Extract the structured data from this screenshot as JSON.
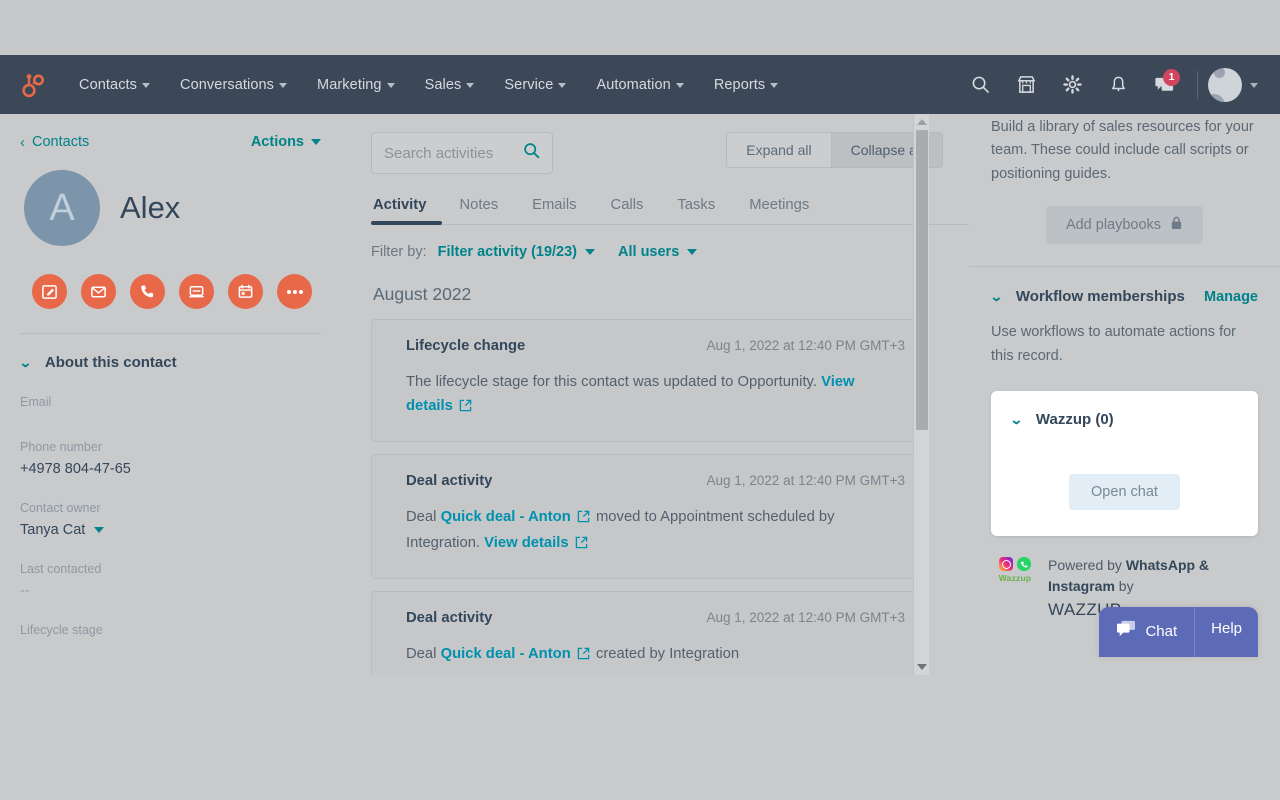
{
  "navbar": {
    "logo_icon": "hubspot-sprocket-logo",
    "menu": [
      {
        "label": "Contacts",
        "has_caret": true
      },
      {
        "label": "Conversations",
        "has_caret": true
      },
      {
        "label": "Marketing",
        "has_caret": true
      },
      {
        "label": "Sales",
        "has_caret": true
      },
      {
        "label": "Service",
        "has_caret": true
      },
      {
        "label": "Automation",
        "has_caret": true
      },
      {
        "label": "Reports",
        "has_caret": true
      }
    ],
    "icons": [
      "search-icon",
      "marketplace-icon",
      "gear-icon",
      "bell-icon",
      "notifications-icon"
    ],
    "notification_count": "1",
    "accent_color": "#e8694a",
    "bar_color": "#3c4858",
    "badge_color": "#d2455f"
  },
  "left_panel": {
    "back_label": "Contacts",
    "actions_label": "Actions",
    "avatar_initial": "A",
    "contact_name": "Alex",
    "quick_actions": [
      {
        "name": "note-icon"
      },
      {
        "name": "email-icon"
      },
      {
        "name": "call-icon"
      },
      {
        "name": "log-activity-icon"
      },
      {
        "name": "meeting-icon"
      },
      {
        "name": "more-icon"
      }
    ],
    "about": {
      "title": "About this contact",
      "fields": [
        {
          "label": "Email",
          "value": ""
        },
        {
          "label": "Phone number",
          "value": "+4978 804-47-65"
        },
        {
          "label": "Contact owner",
          "value": "Tanya Cat",
          "has_caret": true
        },
        {
          "label": "Last contacted",
          "value": "--"
        },
        {
          "label": "Lifecycle stage",
          "value": ""
        }
      ]
    }
  },
  "middle_panel": {
    "search": {
      "placeholder": "Search activities",
      "icon": "search-icon"
    },
    "expand_label": "Expand all",
    "collapse_label": "Collapse all",
    "tabs": [
      {
        "label": "Activity",
        "active": true
      },
      {
        "label": "Notes",
        "active": false
      },
      {
        "label": "Emails",
        "active": false
      },
      {
        "label": "Calls",
        "active": false
      },
      {
        "label": "Tasks",
        "active": false
      },
      {
        "label": "Meetings",
        "active": false
      }
    ],
    "filter_by_label": "Filter by:",
    "filter_activity_label": "Filter activity (19/23)",
    "all_users_label": "All users",
    "month_header": "August 2022",
    "activities": [
      {
        "title": "Lifecycle change",
        "time": "Aug 1, 2022 at 12:40 PM GMT+3",
        "body_pre": "The lifecycle stage for this contact was updated to Opportunity.",
        "link1": "",
        "body_mid": "",
        "link2": "View details",
        "body_post": ""
      },
      {
        "title": "Deal activity",
        "time": "Aug 1, 2022 at 12:40 PM GMT+3",
        "body_pre": "Deal",
        "link1": "Quick deal - Anton",
        "body_mid": "moved to Appointment scheduled by Integration.",
        "link2": "View details",
        "body_post": ""
      },
      {
        "title": "Deal activity",
        "time": "Aug 1, 2022 at 12:40 PM GMT+3",
        "body_pre": "Deal",
        "link1": "Quick deal - Anton",
        "body_mid": "created by Integration",
        "link2": "",
        "body_post": ""
      }
    ]
  },
  "right_panel": {
    "playbooks_text": "Build a library of sales resources for your team. These could include call scripts or positioning guides.",
    "add_playbooks_label": "Add playbooks",
    "add_playbooks_icon": "lock-icon",
    "workflow_title": "Workflow memberships",
    "workflow_manage_label": "Manage",
    "workflow_text": "Use workflows to automate actions for this record.",
    "wazzup": {
      "title": "Wazzup (0)",
      "open_chat_label": "Open chat"
    },
    "powered_by_prefix": "Powered by ",
    "powered_by_bold": "WhatsApp & Instagram",
    "powered_by_suffix": " by",
    "powered_brand": "WAZZUP",
    "powered_logo_word": "Wazzup"
  },
  "chat_widget": {
    "chat_label": "Chat",
    "help_label": "Help",
    "chat_icon": "chat-bubble-icon",
    "color": "#5d6ab7"
  }
}
